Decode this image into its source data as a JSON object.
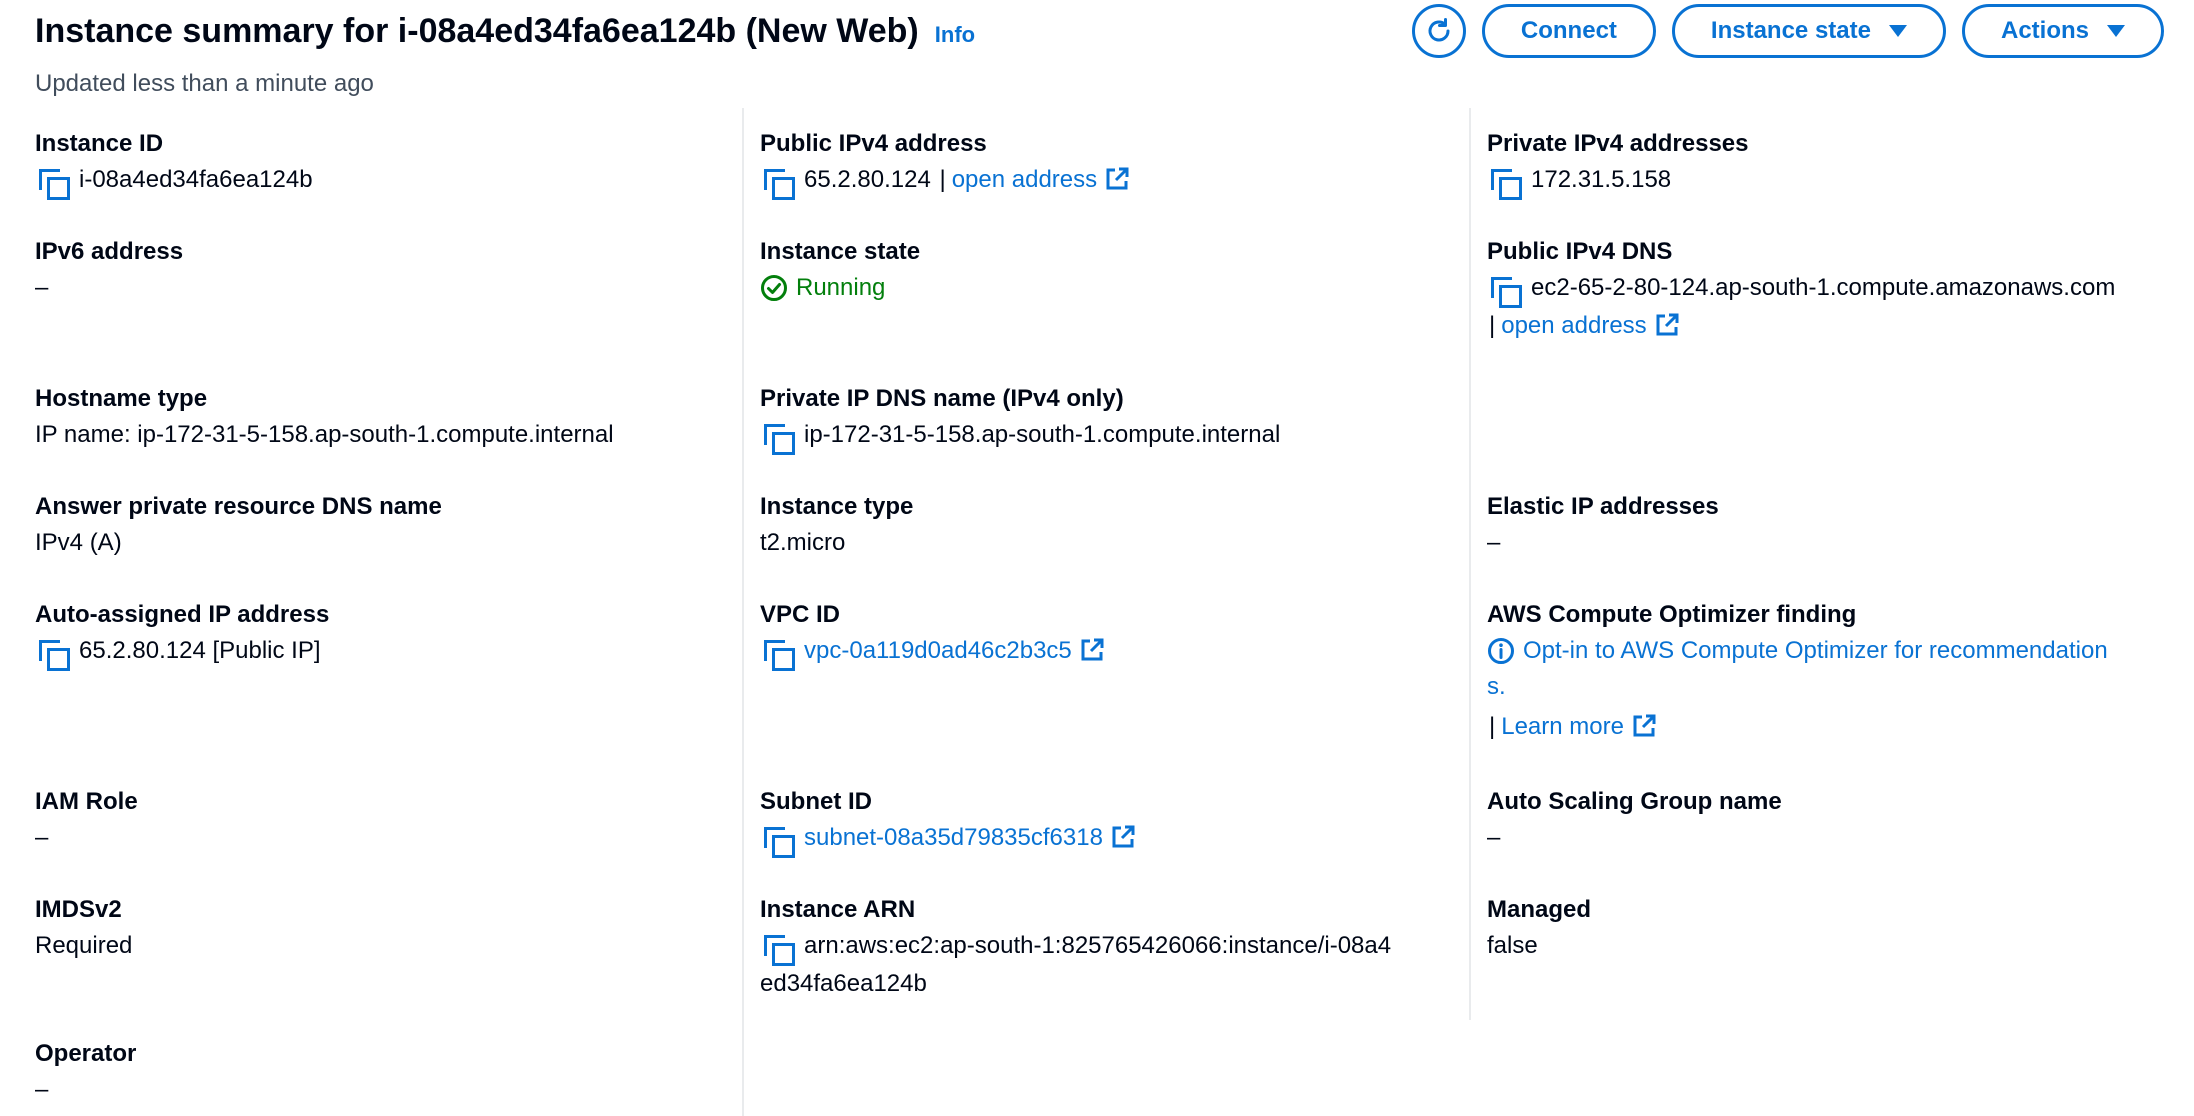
{
  "header": {
    "title": "Instance summary for i-08a4ed34fa6ea124b (New Web)",
    "info_label": "Info",
    "updated_text": "Updated less than a minute ago"
  },
  "actions": {
    "refresh_icon": "refresh-icon",
    "connect_label": "Connect",
    "instance_state_label": "Instance state",
    "actions_label": "Actions"
  },
  "fields": {
    "instance_id": {
      "label": "Instance ID",
      "value": "i-08a4ed34fa6ea124b"
    },
    "public_ipv4": {
      "label": "Public IPv4 address",
      "value": "65.2.80.124",
      "separator": "|",
      "link": "open address"
    },
    "private_ipv4": {
      "label": "Private IPv4 addresses",
      "value": "172.31.5.158"
    },
    "ipv6": {
      "label": "IPv6 address",
      "value": "–"
    },
    "instance_state": {
      "label": "Instance state",
      "value": "Running"
    },
    "public_dns": {
      "label": "Public IPv4 DNS",
      "value": "ec2-65-2-80-124.ap-south-1.compute.amazonaws.com",
      "separator": "|",
      "link": "open address"
    },
    "hostname_type": {
      "label": "Hostname type",
      "value": "IP name: ip-172-31-5-158.ap-south-1.compute.internal"
    },
    "private_dns": {
      "label": "Private IP DNS name (IPv4 only)",
      "value": "ip-172-31-5-158.ap-south-1.compute.internal"
    },
    "answer_dns": {
      "label": "Answer private resource DNS name",
      "value": "IPv4 (A)"
    },
    "instance_type": {
      "label": "Instance type",
      "value": "t2.micro"
    },
    "elastic_ip": {
      "label": "Elastic IP addresses",
      "value": "–"
    },
    "auto_ip": {
      "label": "Auto-assigned IP address",
      "value": "65.2.80.124 [Public IP]"
    },
    "vpc_id": {
      "label": "VPC ID",
      "value": "vpc-0a119d0ad46c2b3c5"
    },
    "optimizer": {
      "label": "AWS Compute Optimizer finding",
      "value": "Opt-in to AWS Compute Optimizer for recommendation",
      "value_wrap": "s.",
      "separator": "|",
      "link": "Learn more"
    },
    "iam_role": {
      "label": "IAM Role",
      "value": "–"
    },
    "subnet_id": {
      "label": "Subnet ID",
      "value": "subnet-08a35d79835cf6318"
    },
    "asg_name": {
      "label": "Auto Scaling Group name",
      "value": "–"
    },
    "imdsv2": {
      "label": "IMDSv2",
      "value": "Required"
    },
    "instance_arn": {
      "label": "Instance ARN",
      "value_line1": "arn:aws:ec2:ap-south-1:825765426066:instance/i-08a4",
      "value_line2": "ed34fa6ea124b"
    },
    "managed": {
      "label": "Managed",
      "value": "false"
    },
    "operator": {
      "label": "Operator",
      "value": "–"
    }
  },
  "colors": {
    "link": "#0972d3",
    "text": "#000716",
    "muted": "#414d5c",
    "success": "#037f0c",
    "divider": "#e9ebed"
  }
}
